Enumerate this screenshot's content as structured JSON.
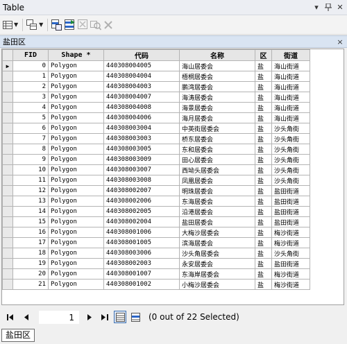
{
  "window": {
    "title": "Table",
    "dropdown_icon": "chevron-down-icon",
    "pin_icon": "pin-icon",
    "close_icon": "close-icon"
  },
  "toolbar": {
    "buttons": [
      {
        "icon": "table-options-icon",
        "has_dropdown": true
      },
      {
        "icon": "related-tables-icon",
        "has_dropdown": true
      },
      {
        "icon": "select-by-attributes-icon"
      },
      {
        "icon": "switch-selection-icon"
      },
      {
        "icon": "clear-selection-icon"
      },
      {
        "icon": "zoom-to-selected-icon"
      },
      {
        "icon": "delete-selected-icon"
      }
    ]
  },
  "layer_tab": {
    "name": "盐田区",
    "close": "×"
  },
  "table": {
    "columns": [
      "FID",
      "Shape *",
      "代码",
      "名称",
      "区",
      "街道"
    ],
    "current_row_marker": "▶",
    "rows": [
      [
        "0",
        "Polygon",
        "440308004005",
        "海山居委会",
        "盐",
        "海山街道"
      ],
      [
        "1",
        "Polygon",
        "440308004004",
        "梧桐居委会",
        "盐",
        "海山街道"
      ],
      [
        "2",
        "Polygon",
        "440308004003",
        "鹏湾居委会",
        "盐",
        "海山街道"
      ],
      [
        "3",
        "Polygon",
        "440308004007",
        "海涛居委会",
        "盐",
        "海山街道"
      ],
      [
        "4",
        "Polygon",
        "440308004008",
        "海景居委会",
        "盐",
        "海山街道"
      ],
      [
        "5",
        "Polygon",
        "440308004006",
        "海月居委会",
        "盐",
        "海山街道"
      ],
      [
        "6",
        "Polygon",
        "440308003004",
        "中英街居委会",
        "盐",
        "沙头角街"
      ],
      [
        "7",
        "Polygon",
        "440308003003",
        "桥东居委会",
        "盐",
        "沙头角街"
      ],
      [
        "8",
        "Polygon",
        "440308003005",
        "东和居委会",
        "盐",
        "沙头角街"
      ],
      [
        "9",
        "Polygon",
        "440308003009",
        "田心居委会",
        "盐",
        "沙头角街"
      ],
      [
        "10",
        "Polygon",
        "440308003007",
        "西坳头居委会",
        "盐",
        "沙头角街"
      ],
      [
        "11",
        "Polygon",
        "440308003008",
        "凤凰居委会",
        "盐",
        "沙头角街"
      ],
      [
        "12",
        "Polygon",
        "440308002007",
        "明珠居委会",
        "盐",
        "盐田街道"
      ],
      [
        "13",
        "Polygon",
        "440308002006",
        "东海居委会",
        "盐",
        "盐田街道"
      ],
      [
        "14",
        "Polygon",
        "440308002005",
        "沿港居委会",
        "盐",
        "盐田街道"
      ],
      [
        "15",
        "Polygon",
        "440308002004",
        "盐田居委会",
        "盐",
        "盐田街道"
      ],
      [
        "16",
        "Polygon",
        "440308001006",
        "大梅沙居委会",
        "盐",
        "梅沙街道"
      ],
      [
        "17",
        "Polygon",
        "440308001005",
        "滨海居委会",
        "盐",
        "梅沙街道"
      ],
      [
        "18",
        "Polygon",
        "440308003006",
        "沙头角居委会",
        "盐",
        "沙头角街"
      ],
      [
        "19",
        "Polygon",
        "440308002003",
        "永安居委会",
        "盐",
        "盐田街道"
      ],
      [
        "20",
        "Polygon",
        "440308001007",
        "东海岸居委会",
        "盐",
        "梅沙街道"
      ],
      [
        "21",
        "Polygon",
        "440308001002",
        "小梅沙居委会",
        "盐",
        "梅沙街道"
      ]
    ]
  },
  "navigation": {
    "first": "⏮",
    "prev": "◀",
    "next": "▶",
    "last": "⏭",
    "current_record": "1",
    "status": "(0 out of 22 Selected)"
  },
  "bottom_tab": {
    "label": "盐田区"
  }
}
